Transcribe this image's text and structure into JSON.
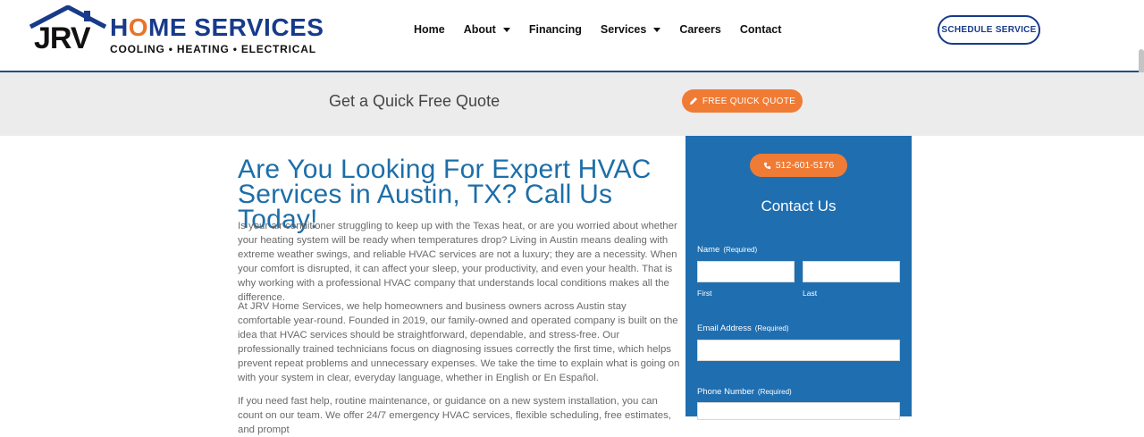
{
  "header": {
    "brand_home": "H",
    "brand_o": "O",
    "brand_rest": "ME SERVICES",
    "brand_monogram": "JRV",
    "tagline": "COOLING • HEATING • ELECTRICAL",
    "nav": [
      {
        "label": "Home",
        "has_caret": false
      },
      {
        "label": "About",
        "has_caret": true
      },
      {
        "label": "Financing",
        "has_caret": false
      },
      {
        "label": "Services",
        "has_caret": true
      },
      {
        "label": "Careers",
        "has_caret": false
      },
      {
        "label": "Contact",
        "has_caret": false
      }
    ],
    "schedule_label": "SCHEDULE SERVICE"
  },
  "quote_bar": {
    "text": "Get a Quick Free Quote",
    "button_label": "FREE QUICK QUOTE"
  },
  "main": {
    "headline": "Are You Looking For Expert HVAC Services in Austin, TX? Call Us Today!",
    "paragraphs": [
      "Is your air conditioner struggling to keep up with the Texas heat, or are you worried about whether your heating system will be ready when temperatures drop? Living in Austin means dealing with extreme weather swings, and reliable HVAC services are not a luxury; they are a necessity. When your comfort is disrupted, it can affect your sleep, your productivity, and even your health. That is why working with a professional HVAC company that understands local conditions makes all the difference.",
      "At JRV Home Services, we help homeowners and business owners across Austin stay comfortable year-round. Founded in 2019, our family-owned and operated company is built on the idea that HVAC services should be straightforward, dependable, and stress-free. Our professionally trained technicians focus on diagnosing issues correctly the first time, which helps prevent repeat problems and unnecessary expenses. We take the time to explain what is going on with your system in clear, everyday language, whether in English or En Español.",
      "If you need fast help, routine maintenance, or guidance on a new system installation, you can count on our team. We offer 24/7 emergency HVAC services, flexible scheduling, free estimates, and prompt"
    ]
  },
  "contact": {
    "phone": "512-601-5176",
    "title": "Contact Us",
    "name_label": "Name",
    "required": "(Required)",
    "first_label": "First",
    "last_label": "Last",
    "email_label": "Email Address",
    "phone_label": "Phone Number"
  },
  "colors": {
    "brand_blue": "#173a8a",
    "accent_orange": "#f07b34",
    "headline_blue": "#1d6ea8",
    "panel_blue": "#1f6eb0"
  }
}
